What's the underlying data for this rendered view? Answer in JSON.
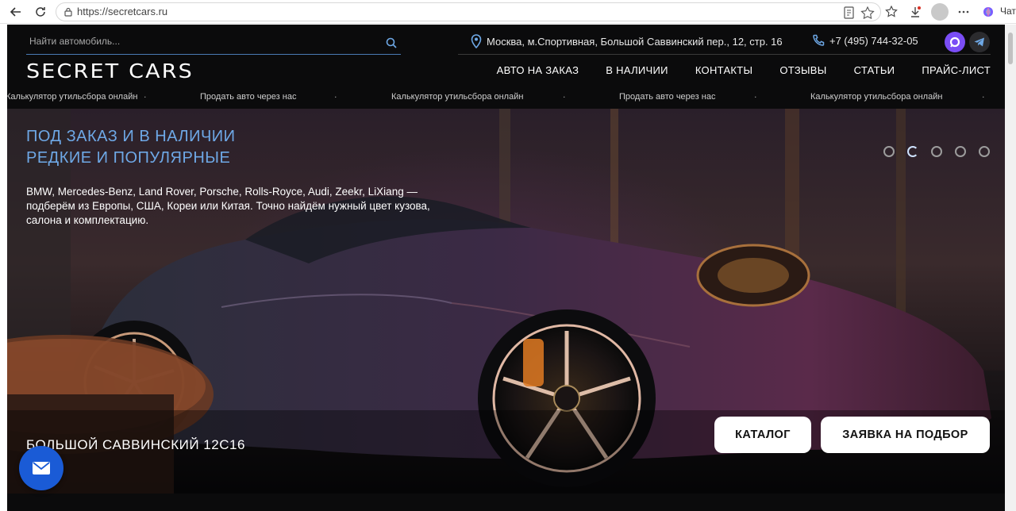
{
  "browser": {
    "url": "https://secretcars.ru",
    "copilot_label": "Чат"
  },
  "header": {
    "search_placeholder": "Найти автомобиль...",
    "address": "Москва, м.Спортивная, Большой Саввинский пер., 12, стр. 16",
    "phone": "+7 (495) 744-32-05",
    "logo": "SECRET CARS",
    "menu": [
      "АВТО НА ЗАКАЗ",
      "В НАЛИЧИИ",
      "КОНТАКТЫ",
      "ОТЗЫВЫ",
      "СТАТЬИ",
      "ПРАЙС-ЛИСТ"
    ]
  },
  "ticker": [
    "Калькулятор утильсбора онлайн",
    "Продать авто через нас",
    "Калькулятор утильсбора онлайн",
    "Продать авто через нас",
    "Калькулятор утильсбора онлайн"
  ],
  "hero": {
    "title_line1": "ПОД ЗАКАЗ И В НАЛИЧИИ",
    "title_line2": "РЕДКИЕ И ПОПУЛЯРНЫЕ",
    "description": "BMW, Mercedes-Benz, Land Rover, Porsche, Rolls-Royce, Audi, Zeekr, LiXiang — подберём из Европы, США, Кореи или Китая. Точно найдём нужный цвет кузова, салона и комплектацию.",
    "address": "БОЛЬШОЙ САВВИНСКИЙ 12С16",
    "catalog_button": "КАТАЛОГ",
    "request_button": "ЗАЯВКА НА ПОДБОР",
    "slides_count": 5,
    "active_slide": 2
  },
  "colors": {
    "accent_blue": "#6ea8e6",
    "fab_blue": "#1a5bd6",
    "page_bg": "#0b0b0c"
  }
}
